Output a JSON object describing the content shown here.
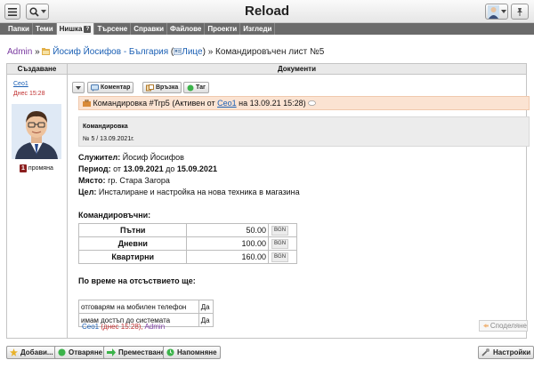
{
  "app": {
    "title": "Reload"
  },
  "nav": [
    {
      "label": "Папки"
    },
    {
      "label": "Теми"
    },
    {
      "label": "Нишка",
      "active": true
    },
    {
      "label": "Търсене"
    },
    {
      "label": "Справки"
    },
    {
      "label": "Файлове"
    },
    {
      "label": "Проекти"
    },
    {
      "label": "Изгледи"
    }
  ],
  "breadcrumb": {
    "root": "Admin",
    "sep": "»",
    "person": "Йосиф Йосифов - България",
    "type_open": "(",
    "type": "Лице",
    "type_close": ")",
    "current": "» Командировъчен лист №5"
  },
  "columns": {
    "left": "Създаване",
    "right": "Документи"
  },
  "creator": {
    "name": "Ceo1",
    "date": "Днес 15:28",
    "change_count": "1",
    "change_label": "промяна"
  },
  "doc_toolbar": {
    "comment": "Коментар",
    "link": "Връзка",
    "tag": "Таг"
  },
  "status": {
    "text": "Командировка #Trp5 (Активен от",
    "user": "Ceo1",
    "rest": "на 13.09.21 15:28)"
  },
  "info": {
    "title": "Командировка",
    "subtitle": "№ 5 / 13.09.2021г."
  },
  "fields": [
    {
      "label": "Служител:",
      "value": "Йосиф Йосифов"
    },
    {
      "label": "Период:",
      "value_a": "от",
      "date_from": "13.09.2021",
      "value_b": "до",
      "date_to": "15.09.2021"
    },
    {
      "label": "Място:",
      "value": "гр. Стара Загора"
    },
    {
      "label": "Цел:",
      "value": "Инсталиране и настройка на нова техника в магазина"
    }
  ],
  "allowance": {
    "heading": "Командировъчни:",
    "currency": "BGN",
    "rows": [
      {
        "label": "Пътни",
        "value": "50.00"
      },
      {
        "label": "Дневни",
        "value": "100.00"
      },
      {
        "label": "Квартирни",
        "value": "160.00"
      }
    ]
  },
  "absence": {
    "heading": "По време на отсъствието ще:",
    "rows": [
      {
        "task": "отговарям на мобилен телефон",
        "answer": "Да"
      },
      {
        "task": "имам достъп до системата",
        "answer": "Да"
      }
    ]
  },
  "footer": {
    "user": "Ceo1",
    "date": "(днес 15:28),",
    "admin": "Admin",
    "share": "Споделяне"
  },
  "bottom_toolbar": {
    "add": "Добави...",
    "open": "Отваряне",
    "move": "Преместване",
    "remind": "Напомняне",
    "settings": "Настройки"
  },
  "colors": {
    "nav_bg": "#6a6a6a",
    "link": "#1a5fb4",
    "status_bg": "#fbe3d2",
    "badge": "#8b1f1f"
  }
}
